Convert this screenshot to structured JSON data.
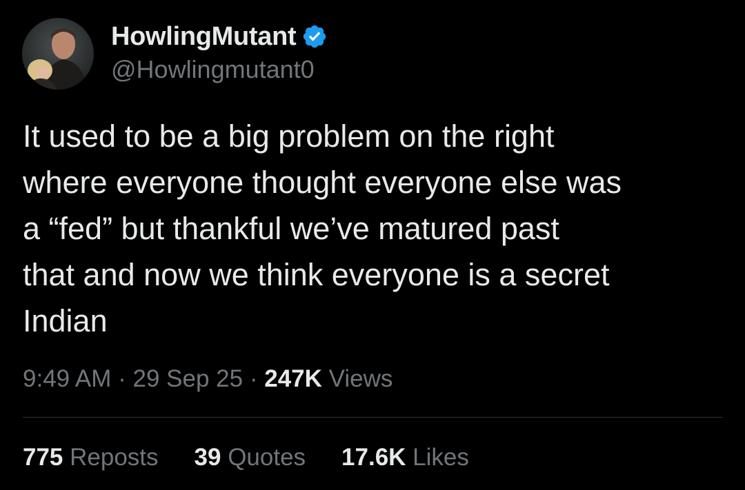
{
  "author": {
    "display_name": "HowlingMutant",
    "handle": "@Howlingmutant0",
    "verified": true,
    "avatar_icon": "profile-photo-avatar",
    "verified_icon": "verified-badge-icon"
  },
  "tweet": {
    "text": "It used to be a big problem on the right\nwhere everyone thought everyone else was\na “fed” but thankful we’ve matured past\nthat and now we think everyone is a secret\nIndian",
    "time": "9:49 AM",
    "separator": " · ",
    "date": "29 Sep 25",
    "views_count": "247K",
    "views_label": " Views"
  },
  "stats": {
    "reposts_count": "775",
    "reposts_label": " Reposts",
    "quotes_count": "39",
    "quotes_label": " Quotes",
    "likes_count": "17.6K",
    "likes_label": " Likes"
  },
  "colors": {
    "background": "#000000",
    "primary_text": "#e7e9ea",
    "secondary_text": "#71767b",
    "divider": "#2f3336",
    "verified_blue": "#1d9bf0"
  }
}
